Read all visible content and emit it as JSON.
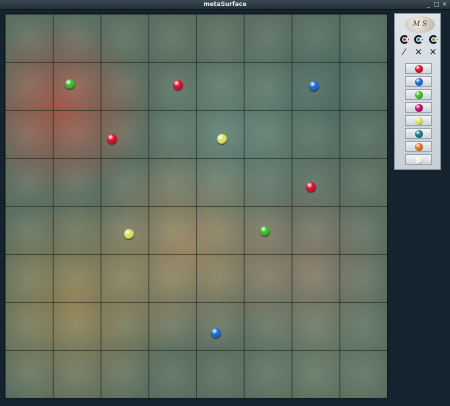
{
  "window": {
    "title": "metaSurface",
    "controls": [
      "_",
      "□",
      "×"
    ]
  },
  "colors": {
    "red": "#d8102a",
    "blue": "#1a6ad0",
    "green": "#3cb82a",
    "magenta": "#c01070",
    "yellow": "#d8e060",
    "teal": "#1a7a88",
    "orange": "#e0702a",
    "white": "#f0f0e8"
  },
  "board": {
    "columns": 8,
    "rows": 8,
    "balls": [
      {
        "color": "green"
      },
      {
        "color": "red"
      },
      {
        "color": "blue"
      },
      {
        "color": "red"
      },
      {
        "color": "yellow"
      },
      {
        "color": "red"
      },
      {
        "color": "yellow"
      },
      {
        "color": "green"
      },
      {
        "color": "blue"
      }
    ]
  },
  "palette": {
    "logo_text": "M  S",
    "tool_icons_row1": [
      "rotate-red-icon",
      "rotate-blue-icon",
      "rotate-green-icon"
    ],
    "tool_icons_row2": [
      "wand-icon",
      "wand-red-icon",
      "wand-green-icon"
    ],
    "swatches": [
      "red",
      "blue",
      "green",
      "magenta",
      "yellow",
      "teal",
      "orange",
      "white"
    ]
  }
}
